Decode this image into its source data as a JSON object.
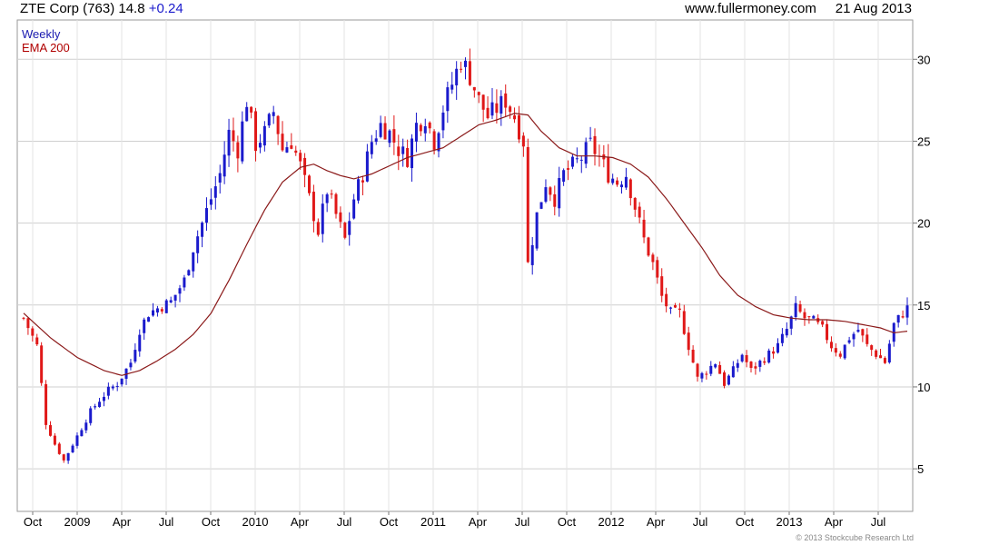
{
  "header": {
    "title": "ZTE Corp (763) 14.8",
    "change": "+0.24",
    "source": "www.fullermoney.com",
    "date": "21 Aug 2013"
  },
  "legend": {
    "series_label": "Weekly",
    "ema_label": "EMA 200"
  },
  "footer": {
    "credit": "© 2013 Stockcube Research Ltd"
  },
  "colors": {
    "up": "#1a1acc",
    "down": "#e01818",
    "ema": "#8b1a1a",
    "grid": "#cfcfcf"
  },
  "chart_data": {
    "type": "line",
    "subtype": "candlestick with EMA overlay",
    "y_ticks": [
      5,
      10,
      15,
      20,
      25,
      30
    ],
    "ylim": [
      2.4,
      32.4
    ],
    "x_tick_labels": [
      "Oct",
      "2009",
      "Apr",
      "Jul",
      "Oct",
      "2010",
      "Apr",
      "Jul",
      "Oct",
      "2011",
      "Apr",
      "Jul",
      "Oct",
      "2012",
      "Apr",
      "Jul",
      "Oct",
      "2013",
      "Apr",
      "Jul"
    ],
    "grid": true,
    "series": [
      {
        "name": "Weekly",
        "approx_close_path": [
          [
            0,
            14.2
          ],
          [
            3,
            12.5
          ],
          [
            5,
            7.8
          ],
          [
            7,
            6.5
          ],
          [
            9,
            5.5
          ],
          [
            11,
            6.5
          ],
          [
            13,
            7.5
          ],
          [
            15,
            8.5
          ],
          [
            17,
            9.2
          ],
          [
            19,
            9.8
          ],
          [
            21,
            10.2
          ],
          [
            24,
            11.5
          ],
          [
            26,
            13.5
          ],
          [
            28,
            14.5
          ],
          [
            30,
            14.8
          ],
          [
            33,
            15.2
          ],
          [
            36,
            16.5
          ],
          [
            38,
            18.5
          ],
          [
            40,
            20.0
          ],
          [
            42,
            21.5
          ],
          [
            44,
            23.0
          ],
          [
            46,
            25.5
          ],
          [
            48,
            24.5
          ],
          [
            50,
            27.5
          ],
          [
            52,
            24.8
          ],
          [
            54,
            25.5
          ],
          [
            56,
            26.8
          ],
          [
            58,
            24.5
          ],
          [
            60,
            25.0
          ],
          [
            62,
            23.5
          ],
          [
            64,
            21.5
          ],
          [
            66,
            19.5
          ],
          [
            68,
            22.0
          ],
          [
            70,
            20.5
          ],
          [
            72,
            19.0
          ],
          [
            74,
            21.5
          ],
          [
            76,
            23.0
          ],
          [
            78,
            25.0
          ],
          [
            80,
            26.0
          ],
          [
            82,
            25.5
          ],
          [
            84,
            24.5
          ],
          [
            86,
            24.0
          ],
          [
            88,
            26.0
          ],
          [
            90,
            26.5
          ],
          [
            92,
            25.0
          ],
          [
            94,
            27.0
          ],
          [
            96,
            28.5
          ],
          [
            98,
            30.0
          ],
          [
            100,
            29.0
          ],
          [
            102,
            27.5
          ],
          [
            104,
            26.5
          ],
          [
            106,
            27.0
          ],
          [
            108,
            27.5
          ],
          [
            110,
            26.5
          ],
          [
            112,
            25.0
          ],
          [
            113,
            17.5
          ],
          [
            115,
            20.5
          ],
          [
            117,
            22.5
          ],
          [
            119,
            21.5
          ],
          [
            121,
            23.0
          ],
          [
            123,
            23.5
          ],
          [
            125,
            24.0
          ],
          [
            127,
            24.8
          ],
          [
            129,
            24.0
          ],
          [
            131,
            23.0
          ],
          [
            133,
            22.5
          ],
          [
            135,
            23.0
          ],
          [
            137,
            21.0
          ],
          [
            139,
            19.0
          ],
          [
            141,
            17.5
          ],
          [
            143,
            15.5
          ],
          [
            145,
            14.5
          ],
          [
            147,
            14.5
          ],
          [
            149,
            12.5
          ],
          [
            151,
            10.5
          ],
          [
            153,
            11.0
          ],
          [
            155,
            11.5
          ],
          [
            157,
            10.2
          ],
          [
            159,
            11.0
          ],
          [
            161,
            12.0
          ],
          [
            163,
            11.0
          ],
          [
            165,
            11.5
          ],
          [
            167,
            12.0
          ],
          [
            169,
            12.5
          ],
          [
            171,
            13.5
          ],
          [
            173,
            14.8
          ],
          [
            175,
            14.2
          ],
          [
            177,
            14.0
          ],
          [
            179,
            13.5
          ],
          [
            181,
            12.5
          ],
          [
            183,
            12.0
          ],
          [
            185,
            13.0
          ],
          [
            187,
            13.5
          ],
          [
            189,
            12.5
          ],
          [
            191,
            12.0
          ],
          [
            193,
            11.5
          ],
          [
            195,
            13.8
          ],
          [
            197,
            14.5
          ],
          [
            198,
            14.8
          ]
        ]
      },
      {
        "name": "EMA 200",
        "approx_path": [
          [
            0,
            14.5
          ],
          [
            6,
            13.0
          ],
          [
            12,
            11.8
          ],
          [
            18,
            11.0
          ],
          [
            22,
            10.7
          ],
          [
            26,
            11.0
          ],
          [
            30,
            11.6
          ],
          [
            34,
            12.3
          ],
          [
            38,
            13.2
          ],
          [
            42,
            14.5
          ],
          [
            46,
            16.5
          ],
          [
            50,
            18.7
          ],
          [
            54,
            20.8
          ],
          [
            58,
            22.5
          ],
          [
            62,
            23.4
          ],
          [
            65,
            23.6
          ],
          [
            68,
            23.2
          ],
          [
            71,
            22.9
          ],
          [
            74,
            22.7
          ],
          [
            78,
            23.0
          ],
          [
            82,
            23.5
          ],
          [
            86,
            24.0
          ],
          [
            90,
            24.3
          ],
          [
            94,
            24.6
          ],
          [
            98,
            25.3
          ],
          [
            102,
            26.0
          ],
          [
            106,
            26.3
          ],
          [
            110,
            26.7
          ],
          [
            113,
            26.6
          ],
          [
            116,
            25.6
          ],
          [
            120,
            24.6
          ],
          [
            124,
            24.1
          ],
          [
            128,
            24.1
          ],
          [
            132,
            24.0
          ],
          [
            136,
            23.6
          ],
          [
            140,
            22.8
          ],
          [
            144,
            21.5
          ],
          [
            148,
            20.0
          ],
          [
            152,
            18.5
          ],
          [
            156,
            16.8
          ],
          [
            160,
            15.6
          ],
          [
            164,
            14.9
          ],
          [
            168,
            14.4
          ],
          [
            172,
            14.2
          ],
          [
            176,
            14.1
          ],
          [
            180,
            14.1
          ],
          [
            184,
            14.0
          ],
          [
            188,
            13.8
          ],
          [
            192,
            13.6
          ],
          [
            195,
            13.3
          ],
          [
            198,
            13.4
          ]
        ]
      }
    ]
  }
}
